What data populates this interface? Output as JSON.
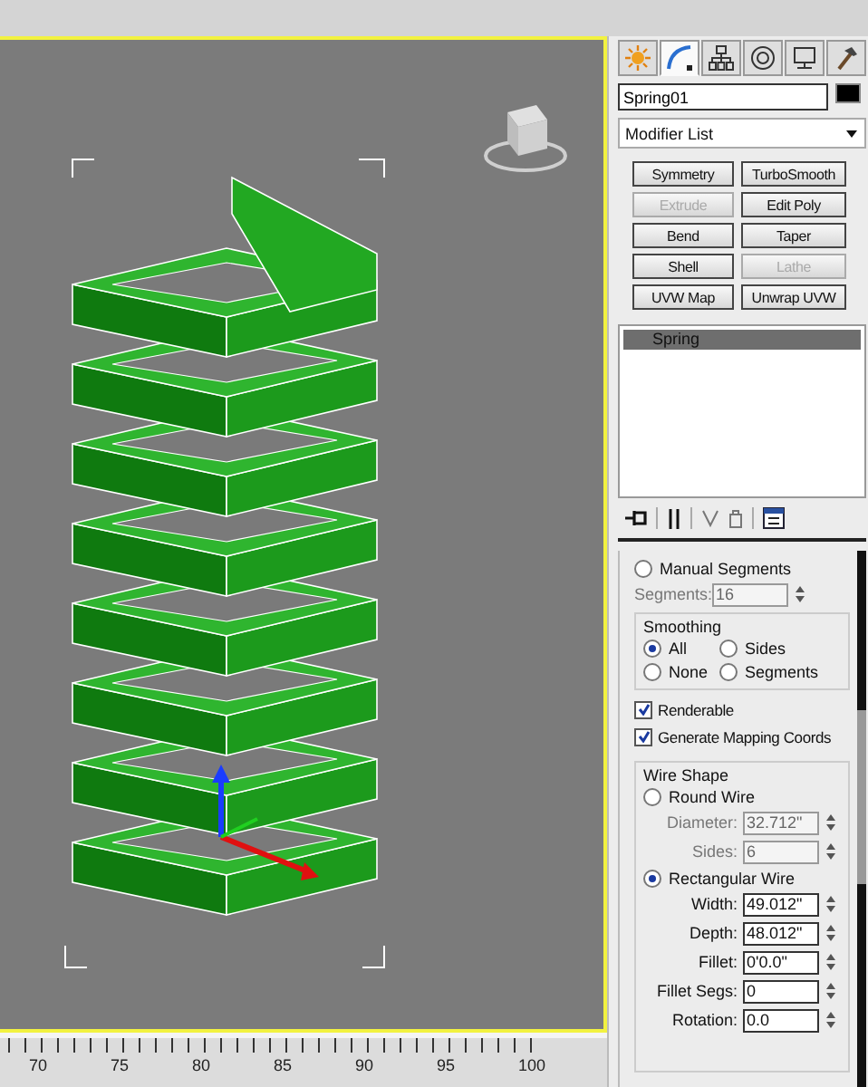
{
  "command_tabs": [
    {
      "kind": "create",
      "selected": false
    },
    {
      "kind": "modify",
      "selected": true
    },
    {
      "kind": "hierarchy",
      "selected": false
    },
    {
      "kind": "motion",
      "selected": false
    },
    {
      "kind": "display",
      "selected": false
    },
    {
      "kind": "utilities",
      "selected": false
    }
  ],
  "object_name": "Spring01",
  "modifier_list": "Modifier List",
  "modifier_buttons": [
    {
      "label": "Symmetry",
      "disabled": false
    },
    {
      "label": "TurboSmooth",
      "disabled": false
    },
    {
      "label": "Extrude",
      "disabled": true
    },
    {
      "label": "Edit Poly",
      "disabled": false
    },
    {
      "label": "Bend",
      "disabled": false
    },
    {
      "label": "Taper",
      "disabled": false
    },
    {
      "label": "Shell",
      "disabled": false
    },
    {
      "label": "Lathe",
      "disabled": true
    },
    {
      "label": "UVW Map",
      "disabled": false
    },
    {
      "label": "Unwrap UVW",
      "disabled": false
    }
  ],
  "modifier_stack": [
    {
      "label": "Spring",
      "selected": true
    }
  ],
  "manual_segments": {
    "label": "Manual Segments",
    "selected": false
  },
  "segments": {
    "label": "Segments:",
    "value": "16",
    "disabled": true
  },
  "smoothing": {
    "title": "Smoothing",
    "options": [
      {
        "label": "All",
        "selected": true
      },
      {
        "label": "Sides",
        "selected": false
      },
      {
        "label": "None",
        "selected": false
      },
      {
        "label": "Segments",
        "selected": false
      }
    ]
  },
  "renderable": {
    "label": "Renderable",
    "checked": true
  },
  "generate_mapping": {
    "label": "Generate Mapping Coords",
    "checked": true
  },
  "wire_shape": {
    "title": "Wire Shape",
    "round": {
      "label": "Round Wire",
      "selected": false
    },
    "round_fields": [
      {
        "label": "Diameter:",
        "value": "32.712\"",
        "disabled": true
      },
      {
        "label": "Sides:",
        "value": "6",
        "disabled": true
      }
    ],
    "rectangular": {
      "label": "Rectangular Wire",
      "selected": true
    },
    "rect_fields": [
      {
        "label": "Width:",
        "value": "49.012\"",
        "disabled": false
      },
      {
        "label": "Depth:",
        "value": "48.012\"",
        "disabled": false
      },
      {
        "label": "Fillet:",
        "value": "0'0.0\"",
        "disabled": false
      },
      {
        "label": "Fillet Segs:",
        "value": "0",
        "disabled": false
      },
      {
        "label": "Rotation:",
        "value": "0.0",
        "disabled": false
      }
    ]
  },
  "timeline_labels": [
    "70",
    "75",
    "80",
    "85",
    "90",
    "95",
    "100"
  ]
}
